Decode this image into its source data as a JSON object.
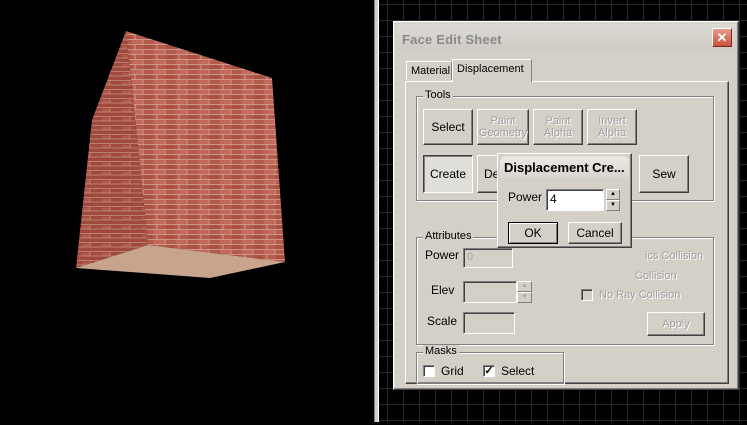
{
  "window": {
    "title": "Face Edit Sheet",
    "close_label": "✕"
  },
  "tabs": [
    {
      "label": "Material"
    },
    {
      "label": "Displacement"
    }
  ],
  "tools": {
    "group_label": "Tools",
    "select_label": "Select",
    "paint_geometry_label": "Paint Geometry",
    "paint_alpha_label": "Paint Alpha",
    "invert_alpha_label": "Invert Alpha",
    "create_label": "Create",
    "destroy_label_partial": "De",
    "sew_label": "Sew"
  },
  "attributes": {
    "group_label": "Attributes",
    "power_label": "Power",
    "power_value": "0",
    "elev_label": "Elev",
    "elev_value": "",
    "scale_label": "Scale",
    "scale_value": "",
    "physics_collision_partial": "ics Collision",
    "collision_partial": "Collision",
    "no_ray_collision_label": "No Ray Collision",
    "apply_label": "Apply"
  },
  "masks": {
    "group_label": "Masks",
    "grid_label": "Grid",
    "grid_checked": false,
    "select_label": "Select",
    "select_checked": true
  },
  "dialog": {
    "title": "Displacement Cre...",
    "power_label": "Power",
    "power_value": "4",
    "ok_label": "OK",
    "cancel_label": "Cancel"
  },
  "viewport3d": {
    "object": "brick cube"
  },
  "colors": {
    "face_bg": "#d4d0c8",
    "brick": "#b0594a",
    "grid": "#2a2a2a"
  }
}
